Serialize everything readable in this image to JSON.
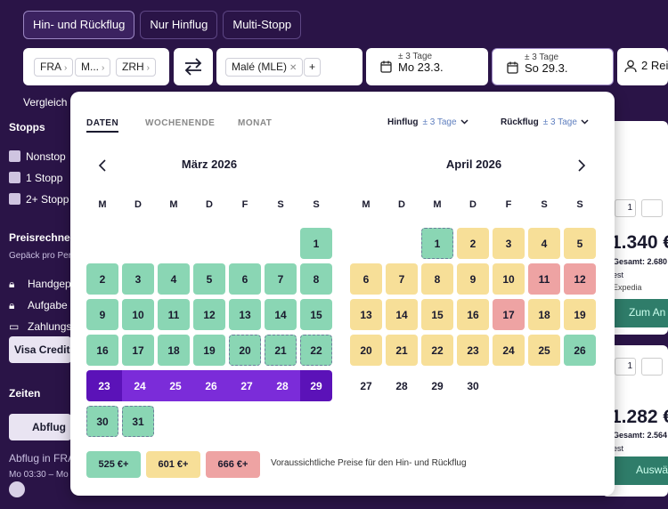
{
  "trip_tabs": [
    "Hin- und Rückflug",
    "Nur Hinflug",
    "Multi-Stopp"
  ],
  "origin_chips": [
    "FRA",
    "M...",
    "ZRH"
  ],
  "destination_chip": "Malé (MLE)",
  "add_label": "+",
  "depart": {
    "flex": "± 3 Tage",
    "date": "Mo 23.3."
  },
  "return": {
    "flex": "± 3 Tage",
    "date": "So 29.3."
  },
  "travelers": "2 Rei",
  "sidebar": {
    "compare": "Vergleich",
    "stops_title": "Stopps",
    "stops": [
      "Nonstop",
      "1 Stopp",
      "2+ Stopp"
    ],
    "price_title": "Preisrechner",
    "price_sub": "Gepäck pro Per",
    "bags": [
      "Handgep",
      "Aufgabe",
      "Zahlungs"
    ],
    "card_select": "Visa Credit",
    "times_title": "Zeiten",
    "depart_btn": "Abflug",
    "depart_in": "Abflug in FRA",
    "time_range": "Mo 03:30 – Mo"
  },
  "results": [
    {
      "price": "1.340 €",
      "total": "Gesamt: 2.680",
      "label": "est",
      "provider": "Expedia",
      "cta": "Zum An"
    },
    {
      "price": "1.282 €",
      "total": "Gesamt: 2.564",
      "label": "est",
      "provider": "",
      "cta": "Auswä"
    }
  ],
  "popup": {
    "tabs": [
      "DATEN",
      "WOCHENENDE",
      "MONAT"
    ],
    "outbound_label": "Hinflug",
    "outbound_flex": "± 3 Tage",
    "return_label": "Rückflug",
    "return_flex": "± 3 Tage",
    "dow": [
      "M",
      "D",
      "M",
      "D",
      "F",
      "S",
      "S"
    ],
    "months": [
      {
        "title": "März 2026",
        "offset": 6,
        "days": 31
      },
      {
        "title": "April 2026",
        "offset": 2,
        "days": 30
      }
    ],
    "legend": [
      {
        "label": "525 €+",
        "color": "#8ad6b4"
      },
      {
        "label": "601 €+",
        "color": "#f7df98"
      },
      {
        "label": "666 €+",
        "color": "#eea3a3"
      }
    ],
    "legend_text": "Voraussichtliche Preise für den Hin- und Rückflug"
  },
  "colors": {
    "green": "#8ad6b4",
    "yellow": "#f7df98",
    "red": "#eea3a3",
    "selected": "#7b2cd9",
    "selected_edge": "#5b12b8"
  }
}
